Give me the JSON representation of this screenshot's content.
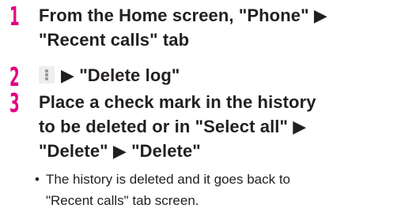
{
  "steps": [
    {
      "number": "1",
      "lines": [
        "From the Home screen, \"Phone\" ▶",
        "\"Recent calls\" tab"
      ]
    },
    {
      "number": "2",
      "icon": "vertical-ellipsis-menu-icon",
      "text": "▶ \"Delete log\""
    },
    {
      "number": "3",
      "lines": [
        "Place a check mark in the history",
        "to be deleted or in \"Select all\" ▶",
        "\"Delete\" ▶ \"Delete\""
      ]
    }
  ],
  "note": {
    "bullet": "•",
    "lines": [
      "The history is deleted and it goes back to",
      "\"Recent calls\" tab screen."
    ]
  },
  "colors": {
    "step_number": "#e4007f",
    "text": "#231f20"
  }
}
